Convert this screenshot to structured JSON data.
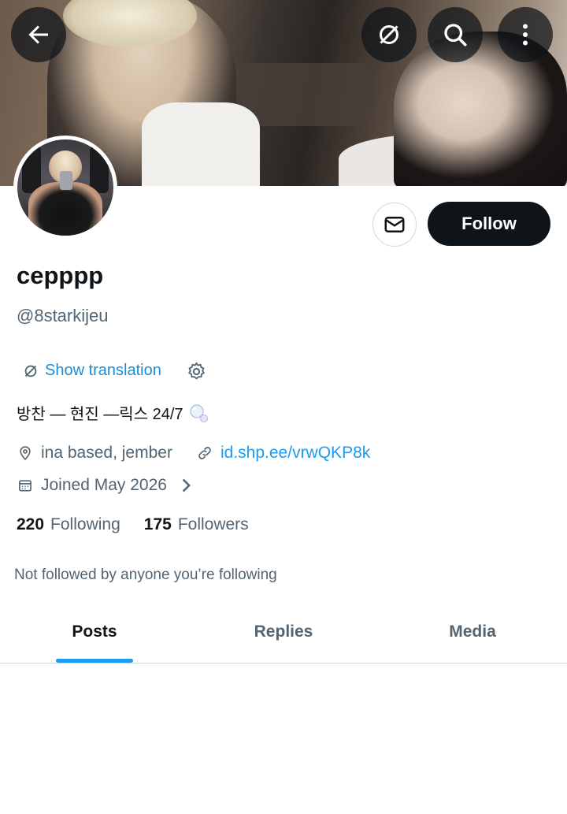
{
  "header": {
    "back_icon": "arrow-left-icon",
    "translate_icon": "translate-off-icon",
    "search_icon": "search-icon",
    "more_icon": "more-vertical-icon"
  },
  "profile": {
    "display_name": "cepppp",
    "handle": "@8starkijeu",
    "follow_label": "Follow",
    "message_icon": "envelope-icon",
    "translation_label": "Show translation",
    "bio": "방찬 — 현진 —릭스  24/7",
    "location": "ina based, jember",
    "website": "id.shp.ee/vrwQKP8k",
    "joined": "Joined May 2026",
    "following_count": "220",
    "following_label": "Following",
    "followers_count": "175",
    "followers_label": "Followers",
    "not_followed_text": "Not followed by anyone you’re following"
  },
  "tabs": [
    {
      "label": "Posts",
      "active": true
    },
    {
      "label": "Replies",
      "active": false
    },
    {
      "label": "Media",
      "active": false
    }
  ],
  "colors": {
    "accent": "#1d9bf0",
    "text_primary": "#0f1419",
    "text_secondary": "#536471",
    "follow_button_bg": "#0f1419"
  }
}
